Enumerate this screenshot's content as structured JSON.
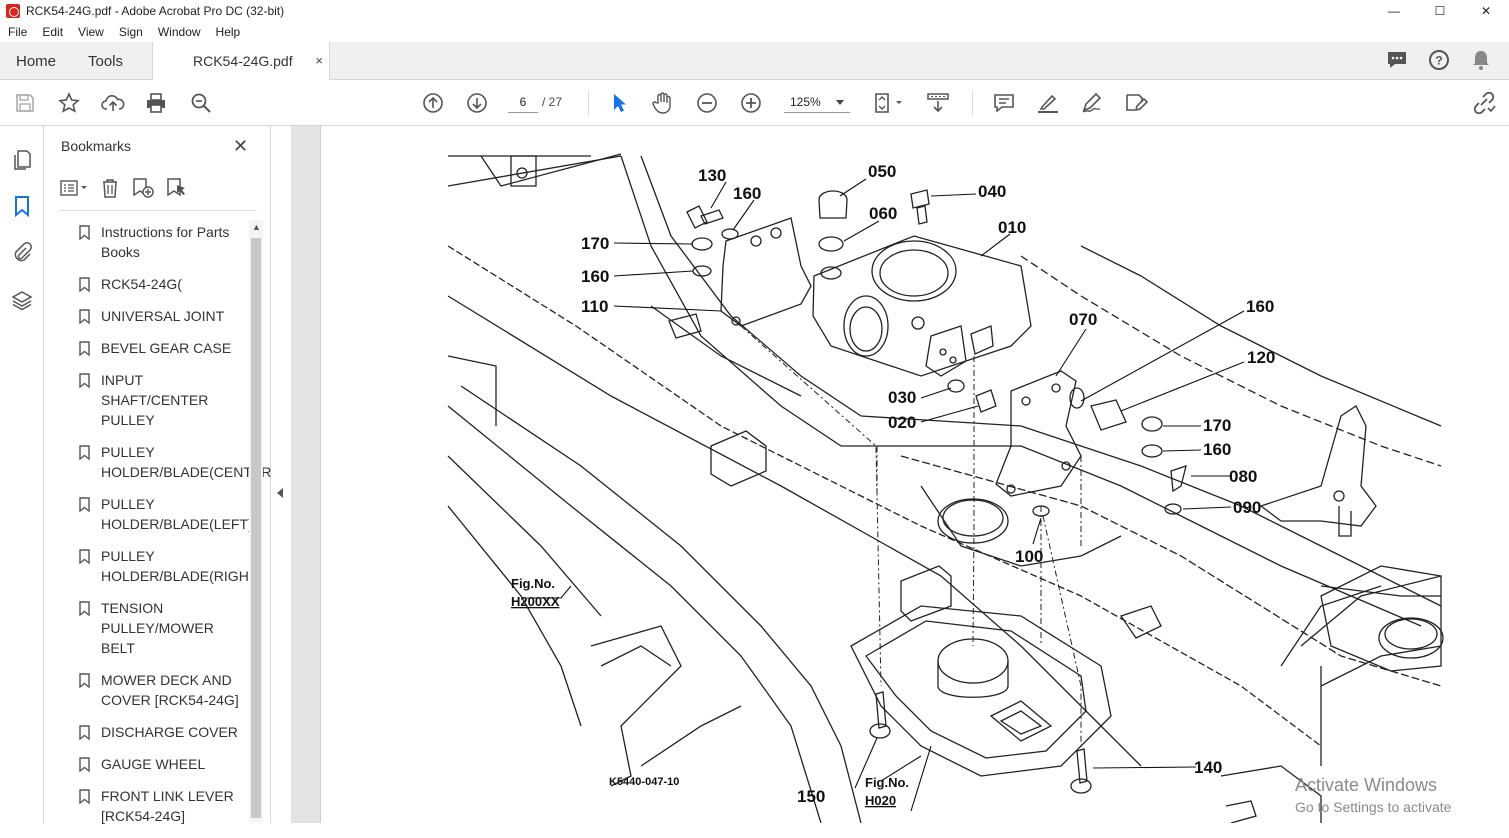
{
  "window": {
    "title": "RCK54-24G.pdf - Adobe Acrobat Pro DC (32-bit)",
    "minimize": "—",
    "maximize": "☐",
    "close": "✕"
  },
  "menu": [
    "File",
    "Edit",
    "View",
    "Sign",
    "Window",
    "Help"
  ],
  "tabs": {
    "home": "Home",
    "tools": "Tools",
    "document": "RCK54-24G.pdf",
    "close": "×"
  },
  "toolbar": {
    "page_current": "6",
    "page_total": "/ 27",
    "zoom": "125%"
  },
  "bookmarks": {
    "title": "Bookmarks",
    "close": "✕",
    "items": [
      "Instructions for Parts Books",
      "RCK54-24G(",
      "UNIVERSAL JOINT",
      "BEVEL GEAR CASE",
      "INPUT SHAFT/CENTER PULLEY",
      "PULLEY HOLDER/BLADE(CENTER)",
      "PULLEY HOLDER/BLADE(LEFT)",
      "PULLEY HOLDER/BLADE(RIGHT)",
      "TENSION PULLEY/MOWER BELT",
      "MOWER DECK AND COVER [RCK54-24G]",
      "DISCHARGE COVER",
      "GAUGE WHEEL",
      "FRONT LINK LEVER [RCK54-24G]"
    ]
  },
  "drawing": {
    "part_numbers": [
      "130",
      "160",
      "050",
      "040",
      "060",
      "010",
      "170",
      "160",
      "110",
      "070",
      "160",
      "120",
      "030",
      "020",
      "170",
      "160",
      "080",
      "090",
      "100",
      "140",
      "150"
    ],
    "fig_ref_left": [
      "Fig.No.",
      "H200XX"
    ],
    "fig_ref_bottom": [
      "Fig.No.",
      "H020"
    ],
    "drawing_code": "K5440-047-10"
  },
  "watermark": {
    "line1": "Activate Windows",
    "line2": "Go to Settings to activate Windows."
  }
}
